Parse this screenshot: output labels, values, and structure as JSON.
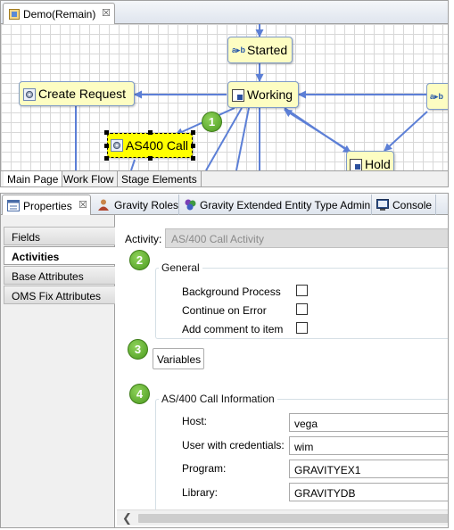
{
  "editor": {
    "tab_title": "Demo(Remain)",
    "tab_close": "☒",
    "nodes": {
      "started": "Started",
      "create_request": "Create Request",
      "working": "Working",
      "as400_call": "AS400 Call",
      "hold": "Hold"
    },
    "bottom_tabs": [
      "Main Page",
      "Work Flow",
      "Stage Elements"
    ]
  },
  "properties": {
    "tabs": [
      {
        "label": "Properties",
        "icon": "properties-icon"
      },
      {
        "label": "Gravity Roles",
        "icon": "roles-icon"
      },
      {
        "label": "Gravity Extended Entity Type Admin",
        "icon": "entity-type-icon"
      },
      {
        "label": "Console",
        "icon": "console-icon"
      }
    ],
    "tab_close": "☒",
    "side_tabs": [
      "Fields",
      "Activities",
      "Base Attributes",
      "OMS Fix Attributes"
    ],
    "activity_label": "Activity:",
    "activity_value": "AS/400 Call Activity",
    "general": {
      "title": "General",
      "background_process": "Background Process",
      "continue_on_error": "Continue on Error",
      "add_comment": "Add comment to item",
      "background_process_checked": false,
      "continue_on_error_checked": false,
      "add_comment_checked": false
    },
    "variables_button": "Variables",
    "as400": {
      "title": "AS/400 Call Information",
      "host_label": "Host:",
      "host_value": "vega",
      "user_label": "User with credentials:",
      "user_value": "wim",
      "program_label": "Program:",
      "program_value": "GRAVITYEX1",
      "library_label": "Library:",
      "library_value": "GRAVITYDB"
    },
    "scroll_left": "❮"
  },
  "markers": [
    "1",
    "2",
    "3",
    "4"
  ],
  "colors": {
    "node_fill": "#fdfdc2",
    "node_selected": "#ffff00",
    "connector": "#5c7fd6",
    "marker_green": "#5fae2e"
  }
}
